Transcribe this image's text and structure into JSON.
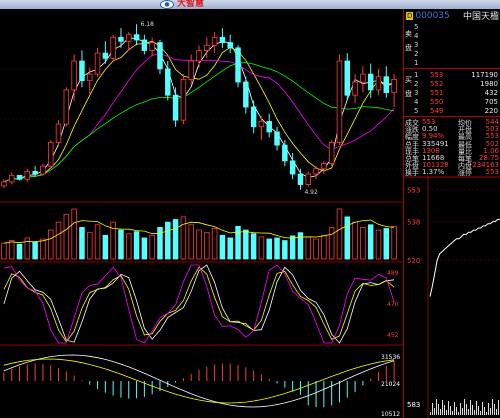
{
  "app": {
    "logo_text": "大智慧",
    "brand_color": "#e0141e",
    "logo_icon": "eye-logo-icon"
  },
  "quote": {
    "code": "000035",
    "name": "中国天楹",
    "flag": "D"
  },
  "order_book": {
    "sell_label_chars": [
      "卖",
      "盘"
    ],
    "buy_label_chars": [
      "买",
      "盘"
    ],
    "sell": [
      {
        "level": "5",
        "price": "",
        "vol": ""
      },
      {
        "level": "4",
        "price": "",
        "vol": ""
      },
      {
        "level": "3",
        "price": "",
        "vol": ""
      },
      {
        "level": "2",
        "price": "",
        "vol": ""
      },
      {
        "level": "1",
        "price": "",
        "vol": ""
      }
    ],
    "buy": [
      {
        "level": "1",
        "price": "553",
        "vol": "117190"
      },
      {
        "level": "2",
        "price": "552",
        "vol": "1980"
      },
      {
        "level": "3",
        "price": "551",
        "vol": "432"
      },
      {
        "level": "4",
        "price": "550",
        "vol": "705"
      },
      {
        "level": "5",
        "price": "549",
        "vol": "220"
      }
    ]
  },
  "stats": [
    {
      "l1": "成交",
      "v1": "553",
      "l2": "均价",
      "v2": "544"
    },
    {
      "l1": "涨跌",
      "v1": "0.50",
      "l2": "开盘",
      "v2": "503"
    },
    {
      "l1": "幅度",
      "v1": "9.94%",
      "l2": "最高",
      "v2": "553"
    },
    {
      "l1": "总手",
      "v1": "335491",
      "l2": "最低",
      "v2": "502"
    },
    {
      "l1": "现手",
      "v1": "1308",
      "l2": "量比",
      "v2": "1.06"
    },
    {
      "l1": "总笔",
      "v1": "11668",
      "l2": "每笔",
      "v2": "28.75"
    },
    {
      "l1": "外盘",
      "v1": "101328",
      "l2": "内盘",
      "v2": "234163"
    },
    {
      "l1": "换手",
      "v1": "1.37%",
      "l2": "涨停",
      "v2": "553"
    }
  ],
  "intraday": {
    "top_label": "553",
    "mid_label": "538",
    "low_label": "520",
    "vol_label": "583",
    "prices": [
      503,
      508,
      514,
      520,
      523,
      524,
      525,
      526,
      527,
      528,
      529,
      530,
      530,
      531,
      532,
      532,
      533,
      533,
      534,
      534,
      535,
      535,
      536,
      536,
      537,
      537,
      538,
      538,
      539,
      539
    ]
  },
  "candle_chart": {
    "hi_annot": "6.18",
    "lo_annot": "4.92",
    "ohlc": [
      [
        4.95,
        5.0,
        4.93,
        4.98
      ],
      [
        4.98,
        5.05,
        4.96,
        5.03
      ],
      [
        5.03,
        5.02,
        4.99,
        5.0
      ],
      [
        5.0,
        5.08,
        4.98,
        5.06
      ],
      [
        5.06,
        5.1,
        5.02,
        5.04
      ],
      [
        5.04,
        5.12,
        5.03,
        5.1
      ],
      [
        5.1,
        5.3,
        5.08,
        5.28
      ],
      [
        5.28,
        5.45,
        5.25,
        5.42
      ],
      [
        5.42,
        5.7,
        5.4,
        5.68
      ],
      [
        5.68,
        5.95,
        5.6,
        5.9
      ],
      [
        5.9,
        5.98,
        5.7,
        5.75
      ],
      [
        5.75,
        5.85,
        5.65,
        5.8
      ],
      [
        5.8,
        6.0,
        5.78,
        5.96
      ],
      [
        5.96,
        6.05,
        5.88,
        5.92
      ],
      [
        5.92,
        6.1,
        5.9,
        6.08
      ],
      [
        6.08,
        6.15,
        6.0,
        6.05
      ],
      [
        6.05,
        6.12,
        5.98,
        6.1
      ],
      [
        6.1,
        6.18,
        6.02,
        6.06
      ],
      [
        6.06,
        6.1,
        5.95,
        5.98
      ],
      [
        5.98,
        6.08,
        5.94,
        6.04
      ],
      [
        6.04,
        6.06,
        5.8,
        5.84
      ],
      [
        5.84,
        5.9,
        5.6,
        5.64
      ],
      [
        5.64,
        5.7,
        5.4,
        5.45
      ],
      [
        5.45,
        5.8,
        5.42,
        5.76
      ],
      [
        5.76,
        5.95,
        5.72,
        5.9
      ],
      [
        5.9,
        6.02,
        5.85,
        5.98
      ],
      [
        5.98,
        6.08,
        5.92,
        6.02
      ],
      [
        6.02,
        6.12,
        5.96,
        6.08
      ],
      [
        6.08,
        6.15,
        6.0,
        6.04
      ],
      [
        6.04,
        6.1,
        5.96,
        6.0
      ],
      [
        6.0,
        6.02,
        5.7,
        5.74
      ],
      [
        5.74,
        5.78,
        5.5,
        5.55
      ],
      [
        5.55,
        5.6,
        5.35,
        5.4
      ],
      [
        5.4,
        5.48,
        5.3,
        5.44
      ],
      [
        5.44,
        5.5,
        5.32,
        5.36
      ],
      [
        5.36,
        5.4,
        5.22,
        5.26
      ],
      [
        5.26,
        5.3,
        5.1,
        5.14
      ],
      [
        5.14,
        5.2,
        5.0,
        5.04
      ],
      [
        5.04,
        5.08,
        4.92,
        4.96
      ],
      [
        4.96,
        5.06,
        4.94,
        5.04
      ],
      [
        5.04,
        5.1,
        5.0,
        5.08
      ],
      [
        5.08,
        5.14,
        5.04,
        5.12
      ],
      [
        5.12,
        5.3,
        5.1,
        5.28
      ],
      [
        5.28,
        5.95,
        5.26,
        5.9
      ],
      [
        5.9,
        5.96,
        5.6,
        5.64
      ],
      [
        5.64,
        5.8,
        5.58,
        5.74
      ],
      [
        5.74,
        5.86,
        5.66,
        5.8
      ],
      [
        5.8,
        5.88,
        5.62,
        5.68
      ],
      [
        5.68,
        5.84,
        5.64,
        5.78
      ],
      [
        5.78,
        5.86,
        5.62,
        5.66
      ],
      [
        5.66,
        5.8,
        5.55,
        5.76
      ]
    ],
    "volumes": [
      30,
      35,
      28,
      40,
      32,
      38,
      55,
      70,
      85,
      95,
      60,
      50,
      65,
      45,
      70,
      55,
      48,
      52,
      40,
      45,
      60,
      70,
      75,
      80,
      65,
      55,
      50,
      58,
      45,
      40,
      62,
      55,
      48,
      42,
      38,
      40,
      35,
      44,
      50,
      42,
      38,
      45,
      60,
      95,
      80,
      70,
      60,
      65,
      55,
      58,
      62
    ]
  },
  "indicator_panel": {
    "right_labels": [
      "489",
      "470",
      "452"
    ]
  },
  "macd_panel": {
    "right_labels": [
      "31536",
      "21024",
      "10512"
    ]
  },
  "colors": {
    "up": "#ff3b3b",
    "down": "#54ffff",
    "ma1": "#ffffff",
    "ma2": "#ffff00",
    "ma3": "#ff00ff",
    "ma4": "#00ff00"
  }
}
